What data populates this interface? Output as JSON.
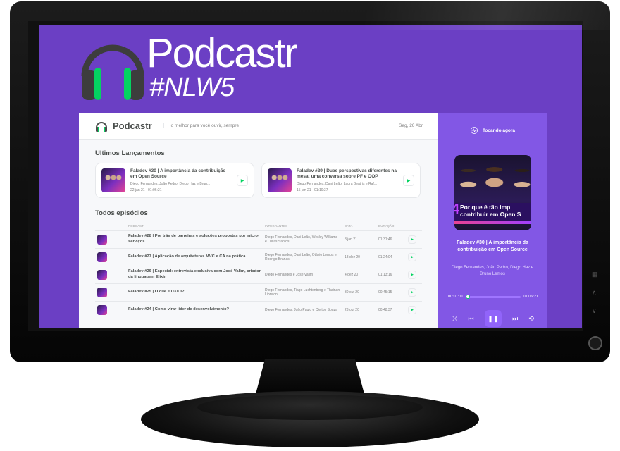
{
  "branding": {
    "title": "Podcastr",
    "tag": "#NLW5"
  },
  "header": {
    "brand": "Podcastr",
    "motto": "o melhor para você ouvir, sempre",
    "date": "Seg, 26 Abr"
  },
  "latest": {
    "section_title": "Ultimos Lançamentos",
    "episodes": [
      {
        "title": "Faladev #30 | A importância da contribuição em Open Source",
        "members": "Diego Fernandes, João Pedro, Diego Haz e Brun...",
        "meta": "22 jan 21  ·  01:06:21"
      },
      {
        "title": "Faladev #29 | Duas perspectivas diferentes na mesa: uma conversa sobre PF e OOP",
        "members": "Diego Fernandes, Dani Leão, Laura Beatris e Raf...",
        "meta": "15 jan 21  ·  01:10:37"
      }
    ]
  },
  "all": {
    "section_title": "Todos episódios",
    "columns": [
      "",
      "PODCAST",
      "INTEGRANTES",
      "DATA",
      "DURAÇÃO",
      ""
    ],
    "rows": [
      {
        "title": "Faladev #28 | Por trás de barreiras e soluções propostas por micro-serviços",
        "members": "Diego Fernandes, Dani Leão, Wesley Williams e Lucas Santos",
        "date": "8 jan 21",
        "duration": "01:31:46"
      },
      {
        "title": "Faladev #27 | Aplicação de arquiteturas MVC e CA na prática",
        "members": "Diego Fernandes, Dani Leão, Otávio Lemos e Rodrigo Branas",
        "date": "18 dez 20",
        "duration": "01:24:04"
      },
      {
        "title": "Faladev #26 | Especial: entrevista exclusiva com José Valim, criador da linguagem Elixir",
        "members": "Diego Fernandes e José Valim",
        "date": "4 dez 20",
        "duration": "01:13:16"
      },
      {
        "title": "Faladev #25 | O que é UX/UI?",
        "members": "Diego Fernandes, Tiago Luchtenberg e Thainan Librelon",
        "date": "30 out 20",
        "duration": "00:45:15"
      },
      {
        "title": "Faladev #24 | Como virar líder de desenvolvimento?",
        "members": "Diego Fernandes, João Paulo e Cleiton Souza",
        "date": "23 out 20",
        "duration": "00:48:37"
      }
    ]
  },
  "player": {
    "header": "Tocando agora",
    "cover_number": "4",
    "cover_text_1": "Por que é tão imp",
    "cover_text_2": "contribuir em Open S",
    "title": "Faladev #30 | A importância da contribuição em Open Source",
    "members": "Diego Fernandes, João Pedro, Diego Haz e Bruno Lemos",
    "current_time": "00:01:01",
    "total_time": "01:06:21",
    "progress": 0.03
  },
  "colors": {
    "purple": "#6b3fc4",
    "player_bg": "#8257e5",
    "green": "#04d361",
    "text": "#494d4b"
  }
}
